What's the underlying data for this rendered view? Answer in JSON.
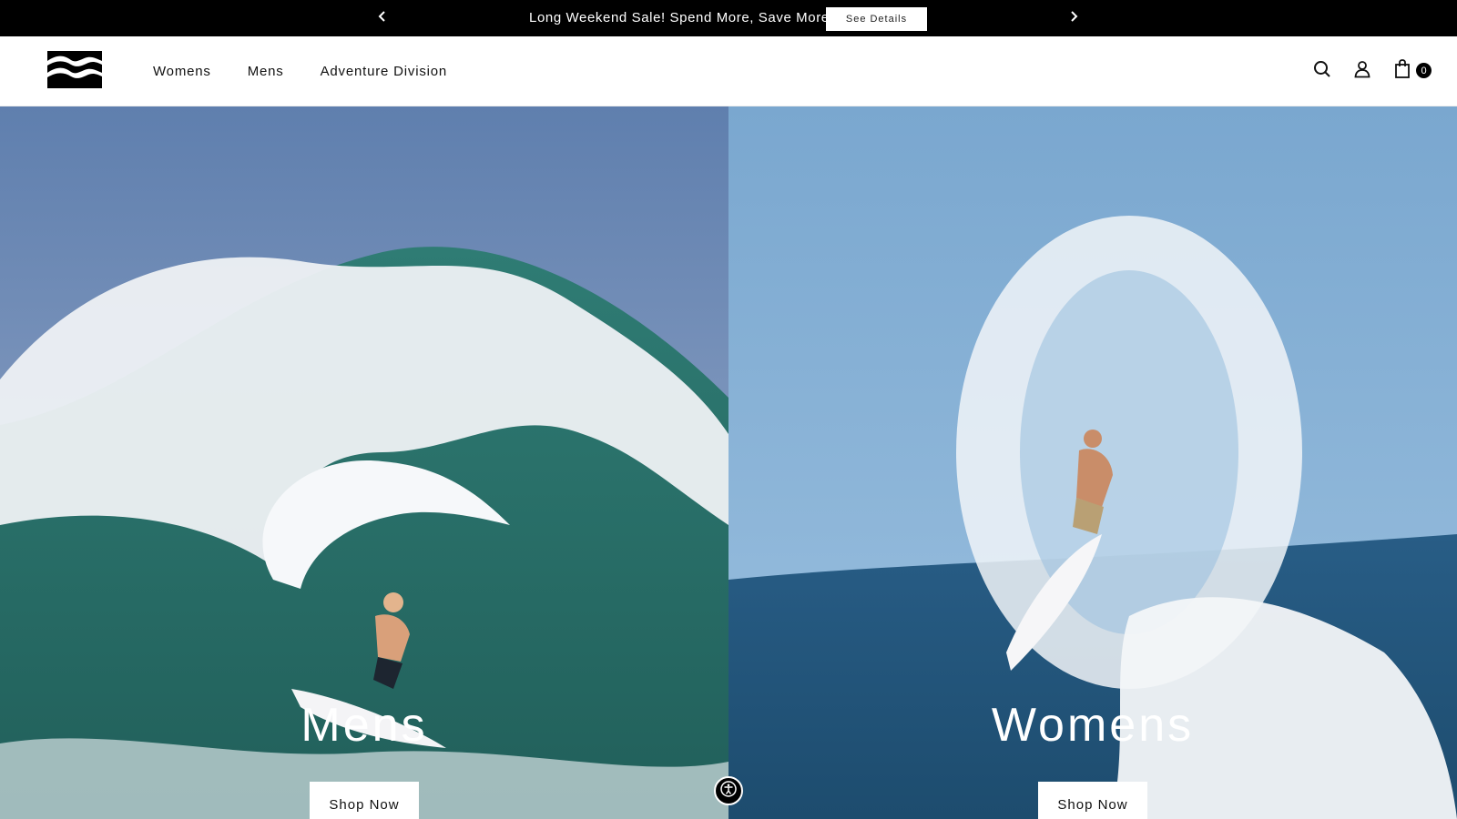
{
  "announcement": {
    "message": "Long Weekend Sale! Spend More, Save More",
    "details_label": "See Details",
    "prev_icon": "chevron-left-icon",
    "next_icon": "chevron-right-icon"
  },
  "header": {
    "logo": "billabong-wave-logo",
    "nav": [
      "Womens",
      "Mens",
      "Adventure Division"
    ],
    "icons": [
      "search-icon",
      "account-icon",
      "cart-icon"
    ],
    "cart_count": "0"
  },
  "hero": {
    "left": {
      "title": "Mens",
      "button": "Shop Now"
    },
    "right": {
      "title": "Womens",
      "button": "Shop Now"
    }
  },
  "accessibility_icon": "accessibility-icon",
  "colors": {
    "bar": "#000000",
    "header": "#ffffff",
    "ocean_left": "#2f6f68",
    "sky_right": "#7aa7cf"
  }
}
